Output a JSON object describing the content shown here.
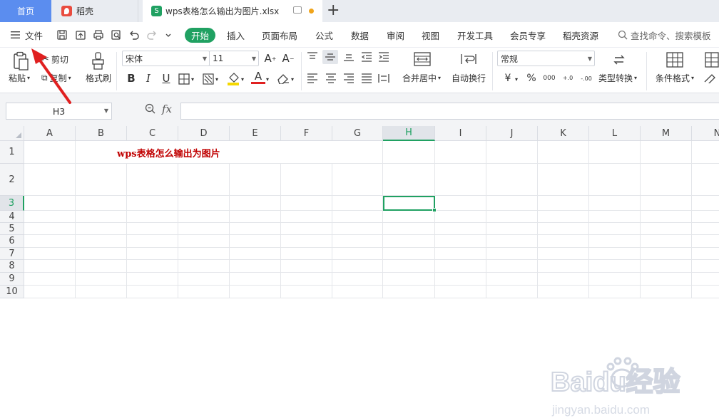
{
  "tabs": {
    "home": "首页",
    "daoke": "稻壳",
    "doc": "wps表格怎么输出为图片.xlsx"
  },
  "menu": {
    "file": "文件",
    "start": "开始",
    "items": [
      "插入",
      "页面布局",
      "公式",
      "数据",
      "审阅",
      "视图",
      "开发工具",
      "会员专享",
      "稻壳资源"
    ],
    "search_placeholder": "查找命令、搜索模板"
  },
  "ribbon": {
    "paste": "粘贴",
    "cut": "剪切",
    "copy": "复制",
    "format_painter": "格式刷",
    "font_name": "宋体",
    "font_size": "11",
    "font_inc": "A⁺",
    "font_dec": "A⁻",
    "merge_center": "合并居中",
    "auto_wrap": "自动换行",
    "number_format": "常规",
    "type_convert": "类型转换",
    "conditional_format": "条件格式",
    "bold": "B",
    "italic": "I",
    "underline": "U",
    "currency": "¥",
    "percent": "%",
    "thousands": "000",
    "dec_inc": "+.0",
    "dec_dec": "-.00"
  },
  "formula_bar": {
    "name_box": "H3",
    "fx": "fx",
    "content": ""
  },
  "sheet": {
    "columns": [
      "A",
      "B",
      "C",
      "D",
      "E",
      "F",
      "G",
      "H",
      "I",
      "J",
      "K",
      "L",
      "M",
      "N"
    ],
    "rows": [
      "1",
      "2",
      "3",
      "4",
      "5",
      "6",
      "7",
      "8",
      "9",
      "10"
    ],
    "selected_column": "H",
    "selected_row": "3",
    "cells": {
      "C1": "wps表格怎么输出为图片"
    }
  },
  "watermark": {
    "brand": "Baidu经验",
    "url": "jingyan.baidu.com"
  },
  "colors": {
    "accent_green": "#20a162",
    "home_tab_blue": "#5b8def",
    "title_red": "#c00000",
    "arrow_red": "#e02020"
  }
}
